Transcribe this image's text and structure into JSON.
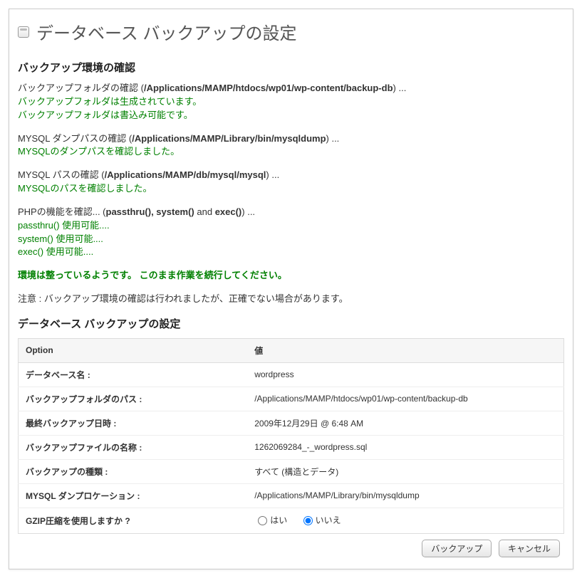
{
  "page_title": "データベース バックアップの設定",
  "env_section_title": "バックアップ環境の確認",
  "env_folder_label": "バックアップフォルダの確認 (",
  "env_folder_path": "/Applications/MAMP/htdocs/wp01/wp-content/backup-db",
  "env_folder_close": ") ...",
  "env_folder_created": "バックアップフォルダは生成されています。",
  "env_folder_writable": "バックアップフォルダは書込み可能です。",
  "env_dump_label": "MYSQL ダンプパスの確認 (",
  "env_dump_path": "/Applications/MAMP/Library/bin/mysqldump",
  "env_dump_close": ") ...",
  "env_dump_ok": "MYSQLのダンプパスを確認しました。",
  "env_mysql_label": "MYSQL パスの確認 (",
  "env_mysql_path": "/Applications/MAMP/db/mysql/mysql",
  "env_mysql_close": ") ...",
  "env_mysql_ok": "MYSQLのパスを確認しました。",
  "env_php_label": "PHPの機能を確認... (",
  "env_php_funcs": "passthru(), system()",
  "env_php_and": " and ",
  "env_php_exec": "exec()",
  "env_php_close": ") ...",
  "env_php_passthru": "passthru() 使用可能....",
  "env_php_system": "system() 使用可能....",
  "env_php_exec_ok": "exec() 使用可能....",
  "env_ready": "環境は整っているようです。 このまま作業を続行してください。",
  "env_note": "注意 :  バックアップ環境の確認は行われましたが、正確でない場合があります。",
  "settings_section_title": "データベース バックアップの設定",
  "col_option": "Option",
  "col_value": "値",
  "rows": {
    "dbname_label": "データベース名 :",
    "dbname_value": "wordpress",
    "folder_label": "バックアップフォルダのパス :",
    "folder_value": "/Applications/MAMP/htdocs/wp01/wp-content/backup-db",
    "last_label": "最終バックアップ日時 :",
    "last_value": "2009年12月29日 @ 6:48 AM",
    "file_label": "バックアップファイルの名称 :",
    "file_value": "1262069284_-_wordpress.sql",
    "type_label": "バックアップの種類 :",
    "type_value": "すべて (構造とデータ)",
    "dumploc_label": "MYSQL ダンプロケーション :",
    "dumploc_value": "/Applications/MAMP/Library/bin/mysqldump",
    "gzip_label": "GZIP圧縮を使用しますか ?",
    "gzip_yes": "はい",
    "gzip_no": "いいえ"
  },
  "btn_backup": "バックアップ",
  "btn_cancel": "キャンセル"
}
